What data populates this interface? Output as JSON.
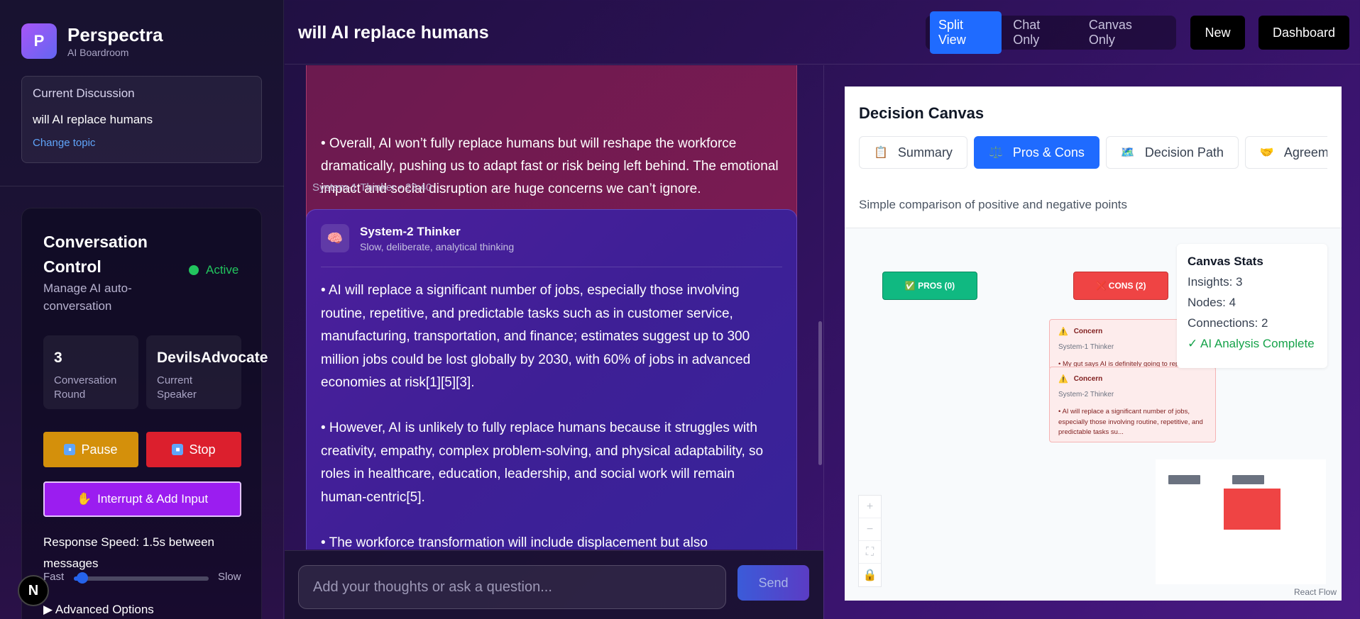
{
  "sidebar": {
    "brand_logo": "P",
    "brand_title": "Perspectra",
    "brand_sub": "AI Boardroom",
    "topic_label": "Current Discussion",
    "topic_value": "will AI replace humans",
    "topic_link": "Change topic",
    "control": {
      "title": "Conversation Control",
      "subtitle": "Manage AI auto-conversation",
      "status": "Active",
      "round_value": "3",
      "round_label": "Conversation Round",
      "speaker_value": "DevilsAdvocate",
      "speaker_label": "Current Speaker",
      "pause_label": "Pause",
      "stop_label": "Stop",
      "interrupt_label": "Interrupt & Add Input",
      "speed_label": "Response Speed: 1.5s between messages",
      "speed_min": "Fast",
      "speed_max": "Slow",
      "speed_level": 0.05,
      "advanced_label": "Advanced Options"
    },
    "badge": "N"
  },
  "header": {
    "title": "will AI replace humans",
    "views": [
      "Split View",
      "Chat Only",
      "Canvas Only"
    ],
    "active_view": "Split View",
    "new_label": "New",
    "dashboard_label": "Dashboard"
  },
  "chat": {
    "messages": [
      {
        "text": "• Overall, AI won’t fully replace humans but will reshape the workforce dramatically, pushing us to adapt fast or risk being left behind. The emotional impact and social disruption are huge concerns we can’t ignore.",
        "meta": "System-1 Thinker  •  23:40"
      },
      {
        "author": "System-2 Thinker",
        "author_desc": "Slow, deliberate, analytical thinking",
        "paragraphs": [
          "• AI will replace a significant number of jobs, especially those involving routine, repetitive, and predictable tasks such as in customer service, manufacturing, transportation, and finance; estimates suggest up to 300 million jobs could be lost globally by 2030, with 60% of jobs in advanced economies at risk[1][5][3].",
          "• However, AI is unlikely to fully replace humans because it struggles with creativity, empathy, complex problem-solving, and physical adaptability, so roles in healthcare, education, leadership, and social work will remain human-centric[5].",
          "• The workforce transformation will include displacement but also"
        ]
      }
    ],
    "input_placeholder": "Add your thoughts or ask a question...",
    "send_label": "Send"
  },
  "canvas": {
    "title": "Decision Canvas",
    "tabs": [
      {
        "icon": "📋",
        "label": "Summary"
      },
      {
        "icon": "⚖️",
        "label": "Pros & Cons"
      },
      {
        "icon": "🗺️",
        "label": "Decision Path"
      },
      {
        "icon": "🤝",
        "label": "Agreement"
      }
    ],
    "active_tab": "Pros & Cons",
    "description": "Simple comparison of positive and negative points",
    "pros_label": "✅ PROS (0)",
    "cons_label": "❌ CONS (2)",
    "concerns": [
      {
        "title": "Concern",
        "by": "System-1 Thinker",
        "body": "• My gut says AI is definitely going to repl..."
      },
      {
        "title": "Concern",
        "by": "System-2 Thinker",
        "body": "• AI will replace a significant number of jobs, especially those involving routine, repetitive, and predictable tasks su..."
      }
    ],
    "stats": {
      "title": "Canvas Stats",
      "insights": "Insights: 3",
      "nodes": "Nodes: 4",
      "connections": "Connections: 2",
      "status": "✓ AI Analysis Complete"
    },
    "zoom": [
      "+",
      "−",
      "⛶",
      "🔒"
    ],
    "attribution": "React Flow"
  }
}
